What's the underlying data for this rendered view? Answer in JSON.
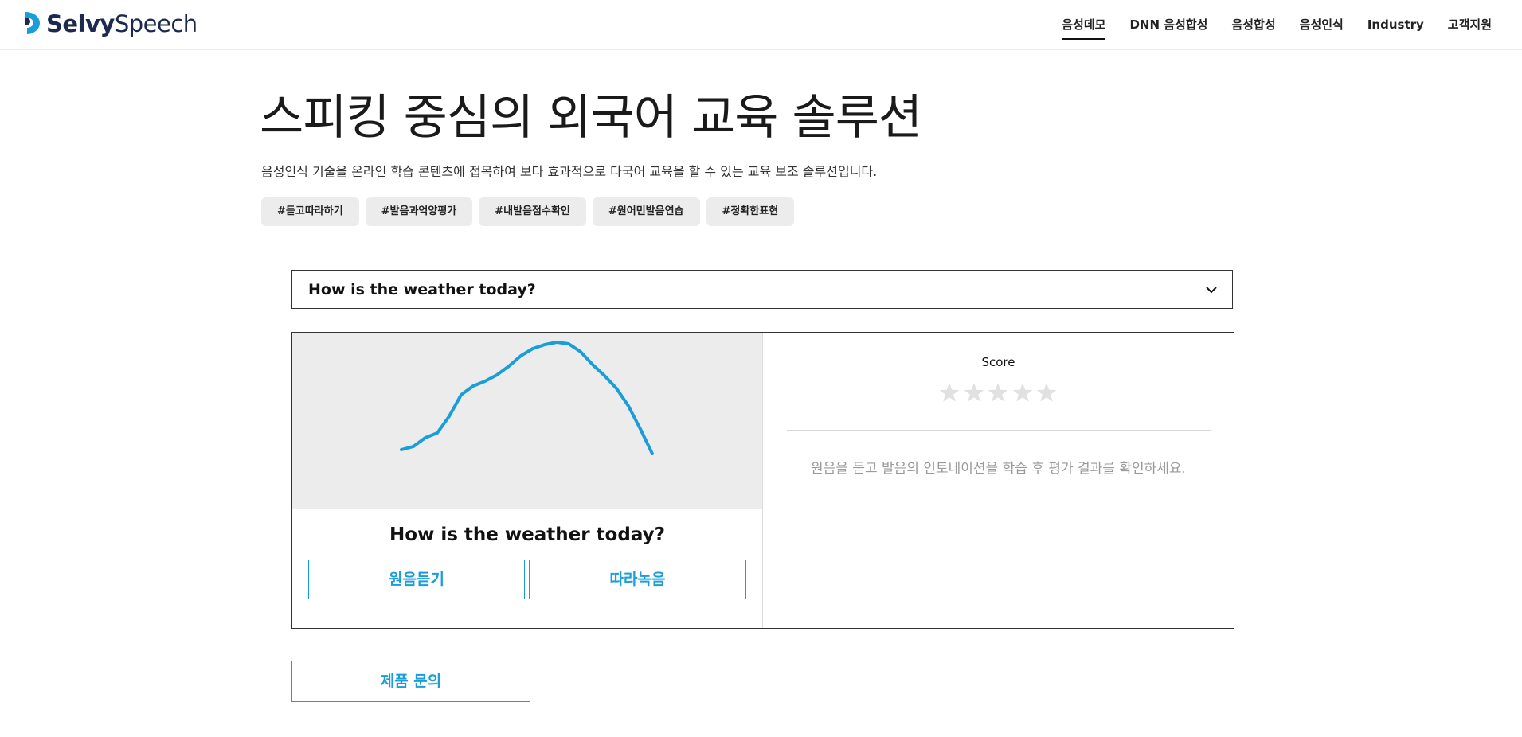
{
  "header": {
    "logo_bold": "Selvy",
    "logo_light": "Speech",
    "nav": [
      {
        "label": "음성데모",
        "active": true
      },
      {
        "label": "DNN 음성합성",
        "active": false
      },
      {
        "label": "음성합성",
        "active": false
      },
      {
        "label": "음성인식",
        "active": false
      },
      {
        "label": "Industry",
        "active": false
      },
      {
        "label": "고객지원",
        "active": false
      }
    ]
  },
  "hero": {
    "title": "스피킹 중심의 외국어 교육 솔루션",
    "subtitle": "음성인식 기술을 온라인 학습 콘텐츠에 접목하여 보다 효과적으로 다국어 교육을 할 수 있는 교육 보조 솔루션입니다.",
    "tags": [
      "#듣고따라하기",
      "#발음과억양평가",
      "#내발음점수확인",
      "#원어민발음연습",
      "#정확한표현"
    ]
  },
  "demo": {
    "selected_sentence": "How is the weather today?",
    "sentence": "How is the weather today?",
    "listen_label": "원음듣기",
    "record_label": "따라녹음",
    "score_label": "Score",
    "score_max": 5,
    "score_value": 0,
    "hint": "원음을 듣고 발음의 인토네이션을 학습 후 평가 결과를 확인하세요.",
    "colors": {
      "accent": "#1a9ed9",
      "graph_bg": "#ececec",
      "star_empty": "#e1e1e1"
    }
  },
  "inquiry": {
    "label": "제품 문의"
  }
}
